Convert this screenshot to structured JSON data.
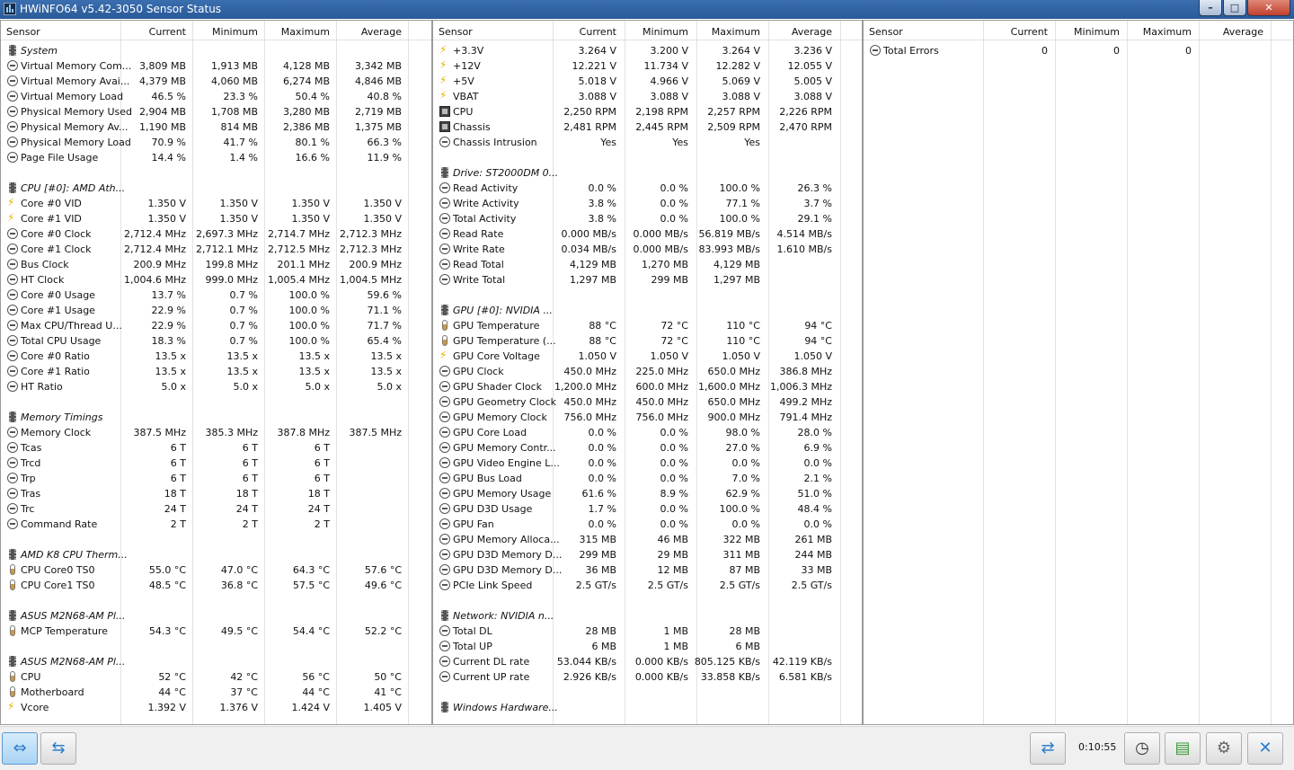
{
  "window": {
    "title": "HWiNFO64 v5.42-3050 Sensor Status"
  },
  "columns": {
    "sensor": "Sensor",
    "current": "Current",
    "minimum": "Minimum",
    "maximum": "Maximum",
    "average": "Average"
  },
  "panels": [
    {
      "rows": [
        {
          "type": "group",
          "label": "System"
        },
        {
          "icon": "clock",
          "label": "Virtual Memory Com...",
          "current": "3,809 MB",
          "min": "1,913 MB",
          "max": "4,128 MB",
          "avg": "3,342 MB"
        },
        {
          "icon": "clock",
          "label": "Virtual Memory Avai...",
          "current": "4,379 MB",
          "min": "4,060 MB",
          "max": "6,274 MB",
          "avg": "4,846 MB"
        },
        {
          "icon": "clock",
          "label": "Virtual Memory Load",
          "current": "46.5 %",
          "min": "23.3 %",
          "max": "50.4 %",
          "avg": "40.8 %"
        },
        {
          "icon": "clock",
          "label": "Physical Memory Used",
          "current": "2,904 MB",
          "min": "1,708 MB",
          "max": "3,280 MB",
          "avg": "2,719 MB"
        },
        {
          "icon": "clock",
          "label": "Physical Memory Av...",
          "current": "1,190 MB",
          "min": "814 MB",
          "max": "2,386 MB",
          "avg": "1,375 MB"
        },
        {
          "icon": "clock",
          "label": "Physical Memory Load",
          "current": "70.9 %",
          "min": "41.7 %",
          "max": "80.1 %",
          "avg": "66.3 %"
        },
        {
          "icon": "clock",
          "label": "Page File Usage",
          "current": "14.4 %",
          "min": "1.4 %",
          "max": "16.6 %",
          "avg": "11.9 %"
        },
        {
          "type": "spacer"
        },
        {
          "type": "group",
          "label": "CPU [#0]: AMD Ath..."
        },
        {
          "icon": "volt",
          "label": "Core #0 VID",
          "current": "1.350 V",
          "min": "1.350 V",
          "max": "1.350 V",
          "avg": "1.350 V"
        },
        {
          "icon": "volt",
          "label": "Core #1 VID",
          "current": "1.350 V",
          "min": "1.350 V",
          "max": "1.350 V",
          "avg": "1.350 V"
        },
        {
          "icon": "clock",
          "label": "Core #0 Clock",
          "current": "2,712.4 MHz",
          "min": "2,697.3 MHz",
          "max": "2,714.7 MHz",
          "avg": "2,712.3 MHz"
        },
        {
          "icon": "clock",
          "label": "Core #1 Clock",
          "current": "2,712.4 MHz",
          "min": "2,712.1 MHz",
          "max": "2,712.5 MHz",
          "avg": "2,712.3 MHz"
        },
        {
          "icon": "clock",
          "label": "Bus Clock",
          "current": "200.9 MHz",
          "min": "199.8 MHz",
          "max": "201.1 MHz",
          "avg": "200.9 MHz"
        },
        {
          "icon": "clock",
          "label": "HT Clock",
          "current": "1,004.6 MHz",
          "min": "999.0 MHz",
          "max": "1,005.4 MHz",
          "avg": "1,004.5 MHz"
        },
        {
          "icon": "clock",
          "label": "Core #0 Usage",
          "current": "13.7 %",
          "min": "0.7 %",
          "max": "100.0 %",
          "avg": "59.6 %"
        },
        {
          "icon": "clock",
          "label": "Core #1 Usage",
          "current": "22.9 %",
          "min": "0.7 %",
          "max": "100.0 %",
          "avg": "71.1 %"
        },
        {
          "icon": "clock",
          "label": "Max CPU/Thread U...",
          "current": "22.9 %",
          "min": "0.7 %",
          "max": "100.0 %",
          "avg": "71.7 %"
        },
        {
          "icon": "clock",
          "label": "Total CPU Usage",
          "current": "18.3 %",
          "min": "0.7 %",
          "max": "100.0 %",
          "avg": "65.4 %"
        },
        {
          "icon": "clock",
          "label": "Core #0 Ratio",
          "current": "13.5 x",
          "min": "13.5 x",
          "max": "13.5 x",
          "avg": "13.5 x"
        },
        {
          "icon": "clock",
          "label": "Core #1 Ratio",
          "current": "13.5 x",
          "min": "13.5 x",
          "max": "13.5 x",
          "avg": "13.5 x"
        },
        {
          "icon": "clock",
          "label": "HT Ratio",
          "current": "5.0 x",
          "min": "5.0 x",
          "max": "5.0 x",
          "avg": "5.0 x"
        },
        {
          "type": "spacer"
        },
        {
          "type": "group",
          "label": "Memory Timings"
        },
        {
          "icon": "clock",
          "label": "Memory Clock",
          "current": "387.5 MHz",
          "min": "385.3 MHz",
          "max": "387.8 MHz",
          "avg": "387.5 MHz"
        },
        {
          "icon": "clock",
          "label": "Tcas",
          "current": "6 T",
          "min": "6 T",
          "max": "6 T",
          "avg": ""
        },
        {
          "icon": "clock",
          "label": "Trcd",
          "current": "6 T",
          "min": "6 T",
          "max": "6 T",
          "avg": ""
        },
        {
          "icon": "clock",
          "label": "Trp",
          "current": "6 T",
          "min": "6 T",
          "max": "6 T",
          "avg": ""
        },
        {
          "icon": "clock",
          "label": "Tras",
          "current": "18 T",
          "min": "18 T",
          "max": "18 T",
          "avg": ""
        },
        {
          "icon": "clock",
          "label": "Trc",
          "current": "24 T",
          "min": "24 T",
          "max": "24 T",
          "avg": ""
        },
        {
          "icon": "clock",
          "label": "Command Rate",
          "current": "2 T",
          "min": "2 T",
          "max": "2 T",
          "avg": ""
        },
        {
          "type": "spacer"
        },
        {
          "type": "group",
          "label": "AMD K8 CPU Therm..."
        },
        {
          "icon": "temp",
          "label": "CPU Core0 TS0",
          "current": "55.0 °C",
          "min": "47.0 °C",
          "max": "64.3 °C",
          "avg": "57.6 °C"
        },
        {
          "icon": "temp",
          "label": "CPU Core1 TS0",
          "current": "48.5 °C",
          "min": "36.8 °C",
          "max": "57.5 °C",
          "avg": "49.6 °C"
        },
        {
          "type": "spacer"
        },
        {
          "type": "group",
          "label": "ASUS M2N68-AM Pl..."
        },
        {
          "icon": "temp",
          "label": "MCP Temperature",
          "current": "54.3 °C",
          "min": "49.5 °C",
          "max": "54.4 °C",
          "avg": "52.2 °C"
        },
        {
          "type": "spacer"
        },
        {
          "type": "group",
          "label": "ASUS M2N68-AM Pl..."
        },
        {
          "icon": "temp",
          "label": "CPU",
          "current": "52 °C",
          "min": "42 °C",
          "max": "56 °C",
          "avg": "50 °C"
        },
        {
          "icon": "temp",
          "label": "Motherboard",
          "current": "44 °C",
          "min": "37 °C",
          "max": "44 °C",
          "avg": "41 °C"
        },
        {
          "icon": "volt",
          "label": "Vcore",
          "current": "1.392 V",
          "min": "1.376 V",
          "max": "1.424 V",
          "avg": "1.405 V"
        }
      ]
    },
    {
      "rows": [
        {
          "icon": "volt",
          "label": "+3.3V",
          "current": "3.264 V",
          "min": "3.200 V",
          "max": "3.264 V",
          "avg": "3.236 V"
        },
        {
          "icon": "volt",
          "label": "+12V",
          "current": "12.221 V",
          "min": "11.734 V",
          "max": "12.282 V",
          "avg": "12.055 V"
        },
        {
          "icon": "volt",
          "label": "+5V",
          "current": "5.018 V",
          "min": "4.966 V",
          "max": "5.069 V",
          "avg": "5.005 V"
        },
        {
          "icon": "volt",
          "label": "VBAT",
          "current": "3.088 V",
          "min": "3.088 V",
          "max": "3.088 V",
          "avg": "3.088 V"
        },
        {
          "icon": "fan",
          "label": "CPU",
          "current": "2,250 RPM",
          "min": "2,198 RPM",
          "max": "2,257 RPM",
          "avg": "2,226 RPM"
        },
        {
          "icon": "fan",
          "label": "Chassis",
          "current": "2,481 RPM",
          "min": "2,445 RPM",
          "max": "2,509 RPM",
          "avg": "2,470 RPM"
        },
        {
          "icon": "clock",
          "label": "Chassis Intrusion",
          "current": "Yes",
          "min": "Yes",
          "max": "Yes",
          "avg": ""
        },
        {
          "type": "spacer"
        },
        {
          "type": "group",
          "label": "Drive: ST2000DM 0..."
        },
        {
          "icon": "clock",
          "label": "Read Activity",
          "current": "0.0 %",
          "min": "0.0 %",
          "max": "100.0 %",
          "avg": "26.3 %"
        },
        {
          "icon": "clock",
          "label": "Write Activity",
          "current": "3.8 %",
          "min": "0.0 %",
          "max": "77.1 %",
          "avg": "3.7 %"
        },
        {
          "icon": "clock",
          "label": "Total Activity",
          "current": "3.8 %",
          "min": "0.0 %",
          "max": "100.0 %",
          "avg": "29.1 %"
        },
        {
          "icon": "clock",
          "label": "Read Rate",
          "current": "0.000 MB/s",
          "min": "0.000 MB/s",
          "max": "56.819 MB/s",
          "avg": "4.514 MB/s"
        },
        {
          "icon": "clock",
          "label": "Write Rate",
          "current": "0.034 MB/s",
          "min": "0.000 MB/s",
          "max": "83.993 MB/s",
          "avg": "1.610 MB/s"
        },
        {
          "icon": "clock",
          "label": "Read Total",
          "current": "4,129 MB",
          "min": "1,270 MB",
          "max": "4,129 MB",
          "avg": ""
        },
        {
          "icon": "clock",
          "label": "Write Total",
          "current": "1,297 MB",
          "min": "299 MB",
          "max": "1,297 MB",
          "avg": ""
        },
        {
          "type": "spacer"
        },
        {
          "type": "group",
          "label": "GPU [#0]: NVIDIA ..."
        },
        {
          "icon": "temp",
          "label": "GPU Temperature",
          "current": "88 °C",
          "min": "72 °C",
          "max": "110 °C",
          "avg": "94 °C"
        },
        {
          "icon": "temp",
          "label": "GPU Temperature (...",
          "current": "88 °C",
          "min": "72 °C",
          "max": "110 °C",
          "avg": "94 °C"
        },
        {
          "icon": "volt",
          "label": "GPU Core Voltage",
          "current": "1.050 V",
          "min": "1.050 V",
          "max": "1.050 V",
          "avg": "1.050 V"
        },
        {
          "icon": "clock",
          "label": "GPU Clock",
          "current": "450.0 MHz",
          "min": "225.0 MHz",
          "max": "650.0 MHz",
          "avg": "386.8 MHz"
        },
        {
          "icon": "clock",
          "label": "GPU Shader Clock",
          "current": "1,200.0 MHz",
          "min": "600.0 MHz",
          "max": "1,600.0 MHz",
          "avg": "1,006.3 MHz"
        },
        {
          "icon": "clock",
          "label": "GPU Geometry Clock",
          "current": "450.0 MHz",
          "min": "450.0 MHz",
          "max": "650.0 MHz",
          "avg": "499.2 MHz"
        },
        {
          "icon": "clock",
          "label": "GPU Memory Clock",
          "current": "756.0 MHz",
          "min": "756.0 MHz",
          "max": "900.0 MHz",
          "avg": "791.4 MHz"
        },
        {
          "icon": "clock",
          "label": "GPU Core Load",
          "current": "0.0 %",
          "min": "0.0 %",
          "max": "98.0 %",
          "avg": "28.0 %"
        },
        {
          "icon": "clock",
          "label": "GPU Memory Contr...",
          "current": "0.0 %",
          "min": "0.0 %",
          "max": "27.0 %",
          "avg": "6.9 %"
        },
        {
          "icon": "clock",
          "label": "GPU Video Engine L...",
          "current": "0.0 %",
          "min": "0.0 %",
          "max": "0.0 %",
          "avg": "0.0 %"
        },
        {
          "icon": "clock",
          "label": "GPU Bus Load",
          "current": "0.0 %",
          "min": "0.0 %",
          "max": "7.0 %",
          "avg": "2.1 %"
        },
        {
          "icon": "clock",
          "label": "GPU Memory Usage",
          "current": "61.6 %",
          "min": "8.9 %",
          "max": "62.9 %",
          "avg": "51.0 %"
        },
        {
          "icon": "clock",
          "label": "GPU D3D Usage",
          "current": "1.7 %",
          "min": "0.0 %",
          "max": "100.0 %",
          "avg": "48.4 %"
        },
        {
          "icon": "clock",
          "label": "GPU Fan",
          "current": "0.0 %",
          "min": "0.0 %",
          "max": "0.0 %",
          "avg": "0.0 %"
        },
        {
          "icon": "clock",
          "label": "GPU Memory Alloca...",
          "current": "315 MB",
          "min": "46 MB",
          "max": "322 MB",
          "avg": "261 MB"
        },
        {
          "icon": "clock",
          "label": "GPU D3D Memory D...",
          "current": "299 MB",
          "min": "29 MB",
          "max": "311 MB",
          "avg": "244 MB"
        },
        {
          "icon": "clock",
          "label": "GPU D3D Memory D...",
          "current": "36 MB",
          "min": "12 MB",
          "max": "87 MB",
          "avg": "33 MB"
        },
        {
          "icon": "clock",
          "label": "PCIe Link Speed",
          "current": "2.5 GT/s",
          "min": "2.5 GT/s",
          "max": "2.5 GT/s",
          "avg": "2.5 GT/s"
        },
        {
          "type": "spacer"
        },
        {
          "type": "group",
          "label": "Network: NVIDIA n..."
        },
        {
          "icon": "clock",
          "label": "Total DL",
          "current": "28 MB",
          "min": "1 MB",
          "max": "28 MB",
          "avg": ""
        },
        {
          "icon": "clock",
          "label": "Total UP",
          "current": "6 MB",
          "min": "1 MB",
          "max": "6 MB",
          "avg": ""
        },
        {
          "icon": "clock",
          "label": "Current DL rate",
          "current": "53.044 KB/s",
          "min": "0.000 KB/s",
          "max": "805.125 KB/s",
          "avg": "42.119 KB/s"
        },
        {
          "icon": "clock",
          "label": "Current UP rate",
          "current": "2.926 KB/s",
          "min": "0.000 KB/s",
          "max": "33.858 KB/s",
          "avg": "6.581 KB/s"
        },
        {
          "type": "spacer"
        },
        {
          "type": "group",
          "label": "Windows Hardware..."
        }
      ]
    },
    {
      "rows": [
        {
          "icon": "clock",
          "label": "Total Errors",
          "current": "0",
          "min": "0",
          "max": "0",
          "avg": ""
        }
      ]
    }
  ],
  "statusbar": {
    "elapsed": "0:10:55"
  },
  "icons": {
    "expand": "expand-arrows-icon",
    "collapse": "collapse-arrows-icon",
    "network": "network-icon",
    "clock": "clock-icon",
    "report": "report-icon",
    "settings": "gear-icon",
    "close": "close-icon"
  }
}
